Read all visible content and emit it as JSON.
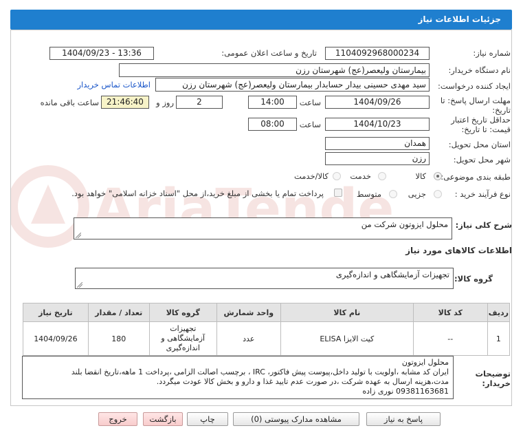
{
  "header": {
    "title": "جزئیات اطلاعات نیاز"
  },
  "fields": {
    "need_number_label": "شماره نیاز:",
    "need_number": "1104092968000234",
    "announce_label": "تاریخ و ساعت اعلان عمومی:",
    "announce_value": "1404/09/23 - 13:36",
    "buyer_org_label": "نام دستگاه خریدار:",
    "buyer_org": "بیمارستان ولیعصر(عج) شهرستان رزن",
    "creator_label": "ایجاد کننده درخواست:",
    "creator": "سید مهدی حسینی بیدار حسابدار بیمارستان ولیعصر(عج) شهرستان رزن",
    "contact_link": "اطلاعات تماس خریدار",
    "deadline_label_1": "مهلت ارسال پاسخ: تا",
    "deadline_label_2": "تاریخ:",
    "deadline_date": "1404/09/26",
    "time_label": "ساعت",
    "deadline_time": "14:00",
    "days_value": "2",
    "days_label": "روز و",
    "remaining_time": "21:46:40",
    "remaining_label": "ساعت باقی مانده",
    "validity_label_1": "حداقل تاریخ اعتبار",
    "validity_label_2": "قیمت: تا تاریخ:",
    "validity_date": "1404/10/23",
    "validity_time": "08:00",
    "province_label": "استان محل تحویل:",
    "province": "همدان",
    "city_label": "شهر محل تحویل:",
    "city": "رزن",
    "category_label": "طبقه بندی موضوعی:",
    "category_options": [
      "کالا",
      "خدمت",
      "کالا/خدمت"
    ],
    "process_label": "نوع فرآیند خرید :",
    "process_options": [
      "جزیی",
      "متوسط"
    ],
    "payment_note": "پرداخت تمام یا بخشی از مبلغ خرید،از محل \"اسناد خزانه اسلامی\" خواهد بود."
  },
  "summary": {
    "label": "شرح کلی نیاز:",
    "value": "محلول ایزوتون شرکت من"
  },
  "goods_section_title": "اطلاعات کالاهای مورد نیاز",
  "goods_group": {
    "label": "گروه کالا:",
    "value": "تجهیزات آزمایشگاهی و اندازه‌گیری"
  },
  "table": {
    "headers": [
      "ردیف",
      "کد کالا",
      "نام کالا",
      "واحد شمارش",
      "گروه کالا",
      "تعداد / مقدار",
      "تاریخ نیاز"
    ],
    "rows": [
      {
        "index": "1",
        "code": "--",
        "name": "کیت الایزا ELISA",
        "unit": "عدد",
        "group": "تجهیزات آزمایشگاهی و اندازه‌گیری",
        "qty": "180",
        "date": "1404/09/26"
      }
    ]
  },
  "buyer_notes": {
    "label_1": "توضیحات",
    "label_2": "خریدار:",
    "lines": [
      "محلول ایزوتون",
      "ایران کد مشابه ،اولویت با تولید داخل،پیوست پیش فاکتور، IRC ، برچسب اصالت الزامی ،پرداخت 1 ماهه،تاریخ انقضا بلند",
      "مدت،هزینه ارسال به عهده شرکت ،در صورت عدم تایید غذا و دارو و بخش کالا عودت میگردد.",
      "09381163681 نوری زاده"
    ]
  },
  "buttons": {
    "reply": "پاسخ به نیاز",
    "attachments": "مشاهده مدارک پیوستی (0)",
    "print": "چاپ",
    "back": "بازگشت",
    "exit": "خروج"
  },
  "colors": {
    "title_bar": "#1f7fcf",
    "remaining_bg": "#f7f3c8",
    "link": "#1a56c9",
    "watermark": "#c0392b"
  },
  "watermark_text": "AriaTender.neT"
}
